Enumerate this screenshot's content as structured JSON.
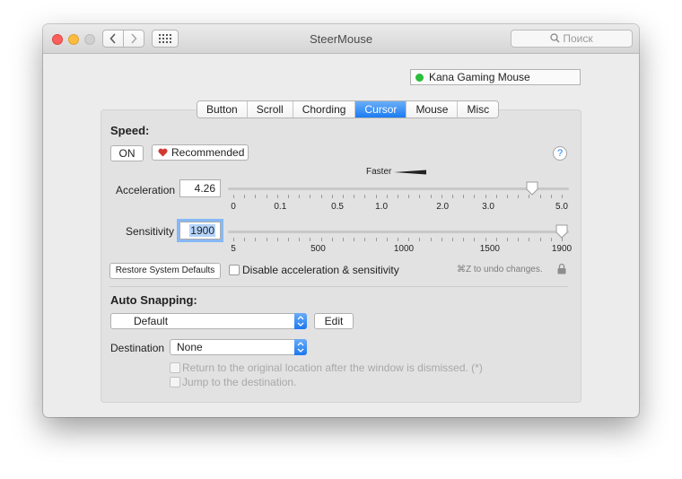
{
  "window": {
    "title": "SteerMouse"
  },
  "toolbar": {
    "back_icon": "chevron-left-icon",
    "forward_icon": "chevron-right-icon",
    "grid_icon": "grid-icon",
    "search_placeholder": "Поиск"
  },
  "device": {
    "name": "Kana Gaming Mouse",
    "status_color": "#2bbd3b"
  },
  "tabs": [
    {
      "label": "Button"
    },
    {
      "label": "Scroll"
    },
    {
      "label": "Chording"
    },
    {
      "label": "Cursor",
      "selected": true
    },
    {
      "label": "Mouse"
    },
    {
      "label": "Misc"
    }
  ],
  "speed": {
    "heading": "Speed:",
    "on_label": "ON",
    "recommended_label": "Recommended",
    "help_label": "?",
    "faster_label": "Faster",
    "acceleration": {
      "label": "Acceleration",
      "value": "4.26",
      "ticks": [
        "0",
        "0.1",
        "0.5",
        "1.0",
        "2.0",
        "3.0",
        "5.0"
      ],
      "slider_fraction": 0.91
    },
    "sensitivity": {
      "label": "Sensitivity",
      "value": "1900",
      "ticks": [
        "5",
        "500",
        "1000",
        "1500",
        "1900"
      ],
      "slider_fraction": 1.0
    },
    "restore_label": "Restore System Defaults",
    "disable_label": "Disable acceleration & sensitivity",
    "undo_hint": "⌘Z to undo changes."
  },
  "snapping": {
    "heading": "Auto Snapping:",
    "preset_value": "Default",
    "edit_label": "Edit",
    "destination_label": "Destination",
    "destination_value": "None",
    "return_label": "Return to the original location after the window is dismissed. (*)",
    "jump_label": "Jump to the destination."
  },
  "colors": {
    "accent": "#1c7cf2",
    "panel": "#e2e2e2",
    "window": "#ececec"
  }
}
